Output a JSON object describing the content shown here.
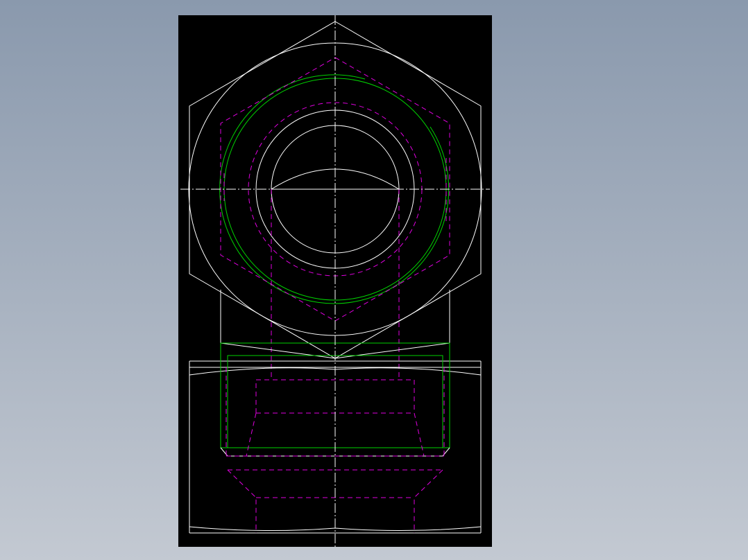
{
  "viewport": {
    "background": "#000000"
  },
  "colors": {
    "outline": "#ffffff",
    "thread": "#00d200",
    "hidden": "#e000e0",
    "centerline": "#ffffff"
  },
  "drawing": {
    "views": [
      "top-view-hex-nut",
      "front-view-section"
    ]
  }
}
